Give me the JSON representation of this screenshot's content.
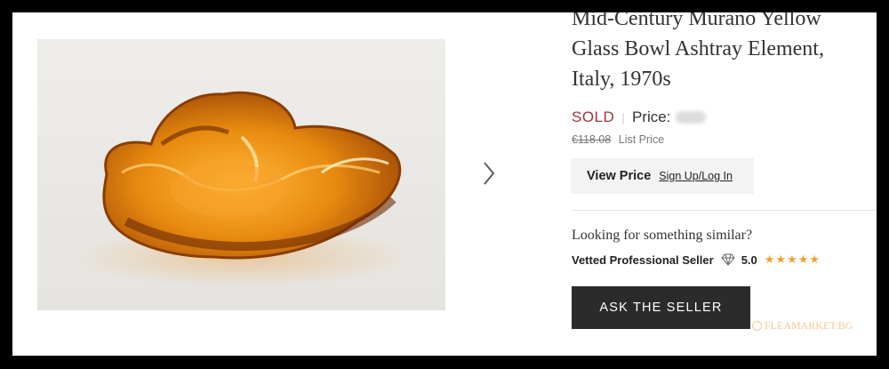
{
  "listing": {
    "title": "Mid-Century Murano Yellow Glass Bowl Ashtray Element, Italy, 1970s",
    "status": "SOLD",
    "price_label": "Price:",
    "list_price_old": "€118.08",
    "list_price_label": "List Price"
  },
  "view_price": {
    "label": "View Price",
    "signup_link": "Sign Up/Log In"
  },
  "seller": {
    "looking_text": "Looking for something similar?",
    "vetted_label": "Vetted Professional Seller",
    "rating": "5.0",
    "stars": "★★★★★"
  },
  "ask_button": "ASK THE SELLER",
  "watermark": "FLEAMARKET.BG",
  "colors": {
    "sold": "#a3333d",
    "button_bg": "#2b2b2b",
    "stars": "#f0a030",
    "glass_amber": "#e0860f"
  },
  "icons": [
    "chevron-right-icon",
    "diamond-icon"
  ]
}
